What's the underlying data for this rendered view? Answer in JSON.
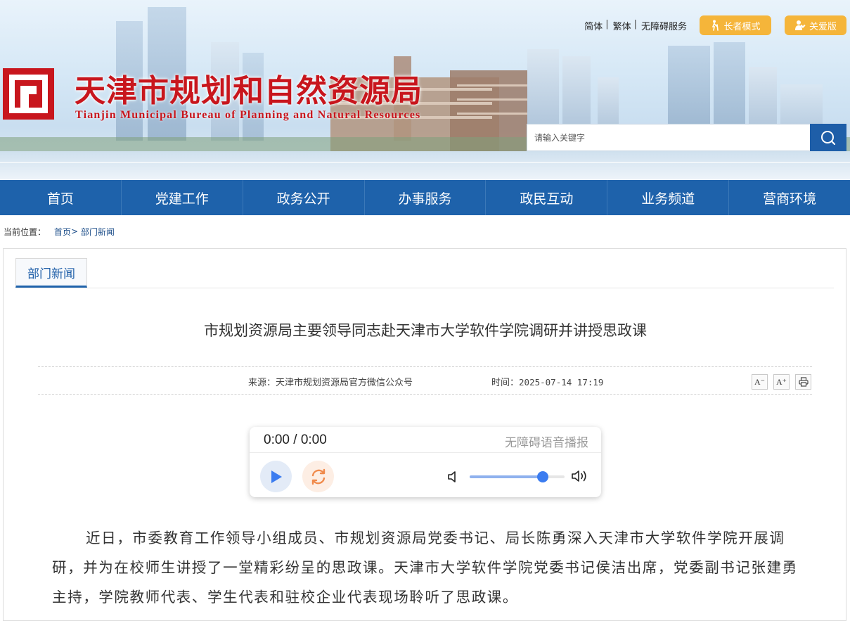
{
  "header": {
    "site_title": "天津市规划和自然资源局",
    "site_subtitle": "Tianjin Municipal Bureau of Planning and Natural Resources",
    "links": [
      "简体",
      "繁体",
      "无障碍服务"
    ],
    "elder_mode_label": "长者模式",
    "care_label": "关爱版",
    "search_placeholder": "请输入关键字"
  },
  "nav": {
    "items": [
      "首页",
      "党建工作",
      "政务公开",
      "办事服务",
      "政民互动",
      "业务频道",
      "营商环境"
    ]
  },
  "breadcrumb": {
    "label": "当前位置：",
    "home": "首页",
    "sep": ">",
    "current": "部门新闻"
  },
  "section": {
    "tab_label": "部门新闻"
  },
  "article": {
    "title": "市规划资源局主要领导同志赴天津市大学软件学院调研并讲授思政课",
    "source": "来源：天津市规划资源局官方微信公众号",
    "time_label": "时间：",
    "time_value": "2025-07-14 17:19",
    "font_smaller": "A⁻",
    "font_larger": "A⁺",
    "body": "近日，市委教育工作领导小组成员、市规划资源局党委书记、局长陈勇深入天津市大学软件学院开展调研，并为在校师生讲授了一堂精彩纷呈的思政课。天津市大学软件学院党委书记侯洁出席，党委副书记张建勇主持，学院教师代表、学生代表和驻校企业代表现场聆听了思政课。"
  },
  "player": {
    "time": "0:00 / 0:00",
    "label": "无障碍语音播报",
    "volume": 0.77
  },
  "colors": {
    "brand_red": "#c8161d",
    "nav_blue": "#1e62ab",
    "pill_orange": "#f5b53a",
    "player_blue": "#3b7cf0",
    "loop_orange": "#f08a4b"
  },
  "icons": [
    "elder-icon",
    "care-icon",
    "search-icon",
    "print-icon",
    "play-icon",
    "loop-icon",
    "mute-icon",
    "volume-icon"
  ]
}
